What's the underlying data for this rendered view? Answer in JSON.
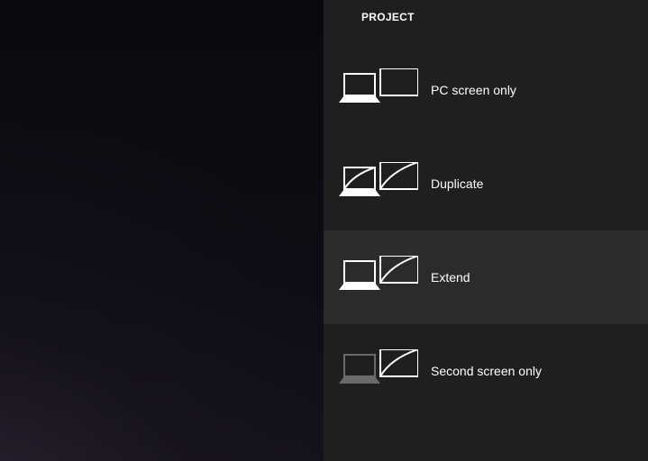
{
  "panel": {
    "title": "PROJECT",
    "options": [
      {
        "label": "PC screen only"
      },
      {
        "label": "Duplicate"
      },
      {
        "label": "Extend"
      },
      {
        "label": "Second screen only"
      }
    ],
    "selected_index": 2
  },
  "colors": {
    "panel_bg": "#1f1f1f",
    "selected_bg": "#2b2b2b",
    "icon_active": "#ffffff",
    "icon_inactive": "#6a6a6a"
  }
}
